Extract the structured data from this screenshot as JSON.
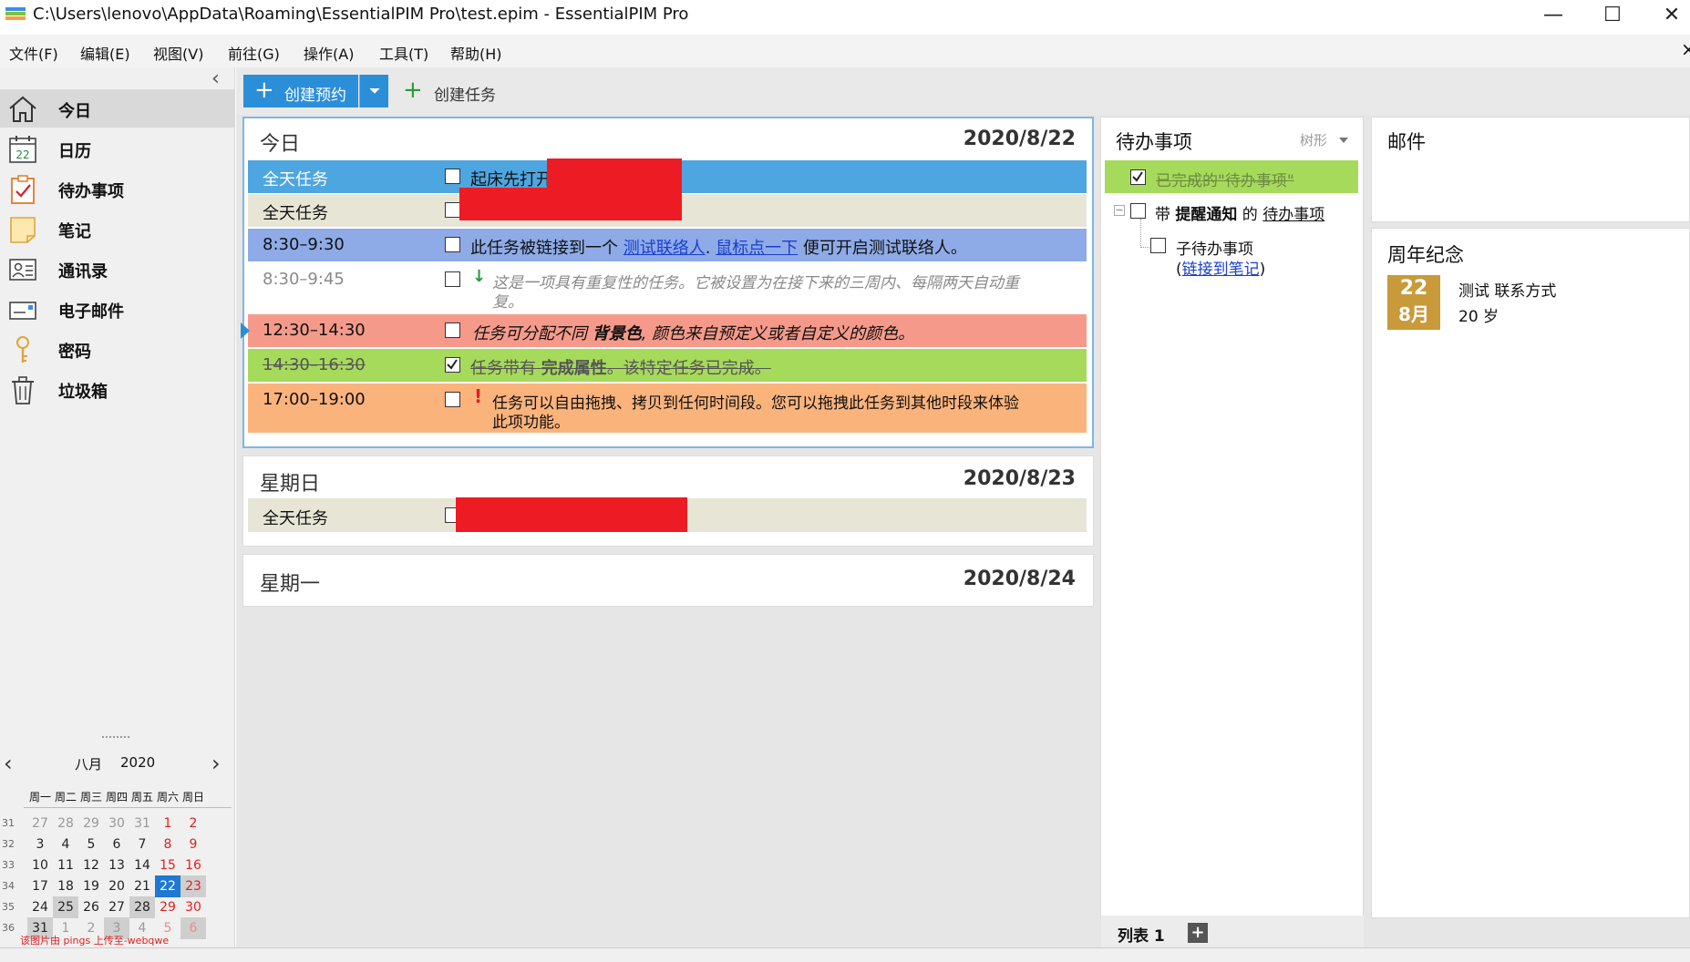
{
  "window": {
    "title": "C:\\Users\\lenovo\\AppData\\Roaming\\EssentialPIM Pro\\test.epim - EssentialPIM Pro",
    "minimize": "—",
    "maximize": "☐",
    "close": "✕"
  },
  "menu": [
    "文件(F)",
    "编辑(E)",
    "视图(V)",
    "前往(G)",
    "操作(A)",
    "工具(T)",
    "帮助(H)"
  ],
  "menu_close": "×",
  "sidebar": {
    "collapse": "‹",
    "items": [
      {
        "label": "今日",
        "icon": "home-icon"
      },
      {
        "label": "日历",
        "icon": "calendar-icon",
        "icon_text": "22"
      },
      {
        "label": "待办事项",
        "icon": "todo-icon"
      },
      {
        "label": "笔记",
        "icon": "note-icon"
      },
      {
        "label": "通讯录",
        "icon": "contacts-icon"
      },
      {
        "label": "电子邮件",
        "icon": "email-icon"
      },
      {
        "label": "密码",
        "icon": "key-icon"
      },
      {
        "label": "垃圾箱",
        "icon": "trash-icon"
      }
    ],
    "selected_index": 0
  },
  "minical": {
    "month": "八月",
    "year": "2020",
    "prev": "‹",
    "next": "›",
    "weekdays": [
      "周一",
      "周二",
      "周三",
      "周四",
      "周五",
      "周六",
      "周日"
    ],
    "weeks": [
      {
        "wk": "31",
        "days": [
          "27",
          "28",
          "29",
          "30",
          "31",
          "1",
          "2"
        ]
      },
      {
        "wk": "32",
        "days": [
          "3",
          "4",
          "5",
          "6",
          "7",
          "8",
          "9"
        ]
      },
      {
        "wk": "33",
        "days": [
          "10",
          "11",
          "12",
          "13",
          "14",
          "15",
          "16"
        ]
      },
      {
        "wk": "34",
        "days": [
          "17",
          "18",
          "19",
          "20",
          "21",
          "22",
          "23"
        ]
      },
      {
        "wk": "35",
        "days": [
          "24",
          "25",
          "26",
          "27",
          "28",
          "29",
          "30"
        ]
      },
      {
        "wk": "36",
        "days": [
          "31",
          "1",
          "2",
          "3",
          "4",
          "5",
          "6"
        ]
      }
    ],
    "today": "22",
    "watermark": "该图片由 pings 上传至-webqwe"
  },
  "toolbar": {
    "create_appointment": "创建预约",
    "create_task": "创建任务"
  },
  "today_panel": {
    "title": "今日",
    "date": "2020/8/22",
    "rows": [
      {
        "time": "全天任务",
        "text": "起床先打开",
        "checked": false,
        "color": "#4ea6e0"
      },
      {
        "time": "全天任务",
        "text": "",
        "checked": false,
        "color": "#e7e6d6"
      },
      {
        "time": "8:30–9:30",
        "text_pre": "此任务被链接到一个 ",
        "link1": "测试联络人",
        "sep": ". ",
        "link2": "鼠标点一下",
        "text_post": " 便可开启测试联络人。",
        "checked": false,
        "color": "#8eabe8"
      },
      {
        "time": "8:30–9:45",
        "marker": "↓",
        "text": "这是一项具有重复性的任务。它被设置为在接下来的三周内、每隔两天自动重",
        "text2": "复。",
        "checked": false,
        "color": "#ffffff"
      },
      {
        "time": "12:30–14:30",
        "text_pre": "任务可分配不同 ",
        "bold": "背景色",
        "text_post": ", 颜色来自预定义或者自定义的颜色。",
        "checked": false,
        "color": "#f59a8a"
      },
      {
        "time": "14:30–16:30",
        "text_pre": "任务带有 ",
        "bold": "完成属性",
        "text_post": "。该特定任务已完成。",
        "checked": true,
        "color": "#a6da5a"
      },
      {
        "time": "17:00–19:00",
        "marker": "!",
        "text": "任务可以自由拖拽、拷贝到任何时间段。您可以拖拽此任务到其他时段来体验",
        "text2": "此项功能。",
        "checked": false,
        "color": "#fbb37c"
      }
    ]
  },
  "sunday_panel": {
    "title": "星期日",
    "date": "2020/8/23",
    "rows": [
      {
        "time": "全天任务",
        "checked": false
      }
    ]
  },
  "monday_panel": {
    "title": "星期一",
    "date": "2020/8/24"
  },
  "todo_panel": {
    "title": "待办事项",
    "view": "树形",
    "items": [
      {
        "text": "已完成的\"待办事项\"",
        "checked": true
      },
      {
        "text_pre": "带 ",
        "bold": "提醒通知",
        "mid": " 的 ",
        "link": "待办事项",
        "checked": false
      },
      {
        "text": "子待办事项",
        "checked": false,
        "sub_open": "(",
        "sub_link": "链接到笔记",
        "sub_close": ")"
      }
    ],
    "list_tab": "列表 1",
    "add": "+"
  },
  "mail_panel": {
    "title": "邮件"
  },
  "anniversary_panel": {
    "title": "周年纪念",
    "day": "22",
    "month": "8月",
    "name": "测试 联系方式",
    "age": "20 岁"
  }
}
